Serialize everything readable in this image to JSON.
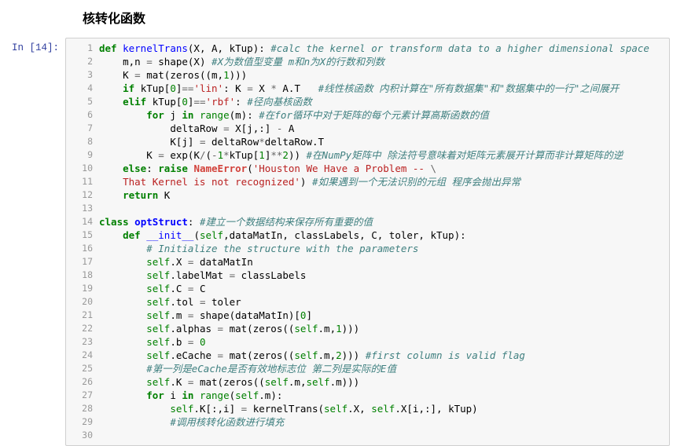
{
  "heading": "核转化函数",
  "prompt": "In [14]:",
  "lines": [
    {
      "n": "1",
      "html": "<span class='k'>def</span> <span class='nf'>kernelTrans</span><span class='n'>(X, A, kTup):</span> <span class='c'>#calc the kernel or transform data to a higher dimensional space</span>"
    },
    {
      "n": "2",
      "html": "    <span class='n'>m,n</span> <span class='o'>=</span> <span class='n'>shape(X)</span> <span class='c'>#X为数值型变量 m和n为X的行数和列数</span>"
    },
    {
      "n": "3",
      "html": "    <span class='n'>K</span> <span class='o'>=</span> <span class='n'>mat(zeros((m,</span><span class='m'>1</span><span class='n'>)))</span>"
    },
    {
      "n": "4",
      "html": "    <span class='k'>if</span> <span class='n'>kTup[</span><span class='m'>0</span><span class='n'>]</span><span class='o'>==</span><span class='s'>'lin'</span><span class='n'>: K</span> <span class='o'>=</span> <span class='n'>X</span> <span class='o'>*</span> <span class='n'>A.T</span>   <span class='c'>#线性核函数 内积计算在\"所有数据集\"和\"数据集中的一行\"之间展开</span>"
    },
    {
      "n": "5",
      "html": "    <span class='k'>elif</span> <span class='n'>kTup[</span><span class='m'>0</span><span class='n'>]</span><span class='o'>==</span><span class='s'>'rbf'</span><span class='n'>:</span> <span class='c'>#径向基核函数</span>"
    },
    {
      "n": "6",
      "html": "        <span class='k'>for</span> <span class='n'>j</span> <span class='k'>in</span> <span class='bi'>range</span><span class='n'>(m):</span> <span class='c'>#在for循环中对于矩阵的每个元素计算高斯函数的值</span>"
    },
    {
      "n": "7",
      "html": "            <span class='n'>deltaRow</span> <span class='o'>=</span> <span class='n'>X[j,:]</span> <span class='o'>-</span> <span class='n'>A</span>"
    },
    {
      "n": "8",
      "html": "            <span class='n'>K[j]</span> <span class='o'>=</span> <span class='n'>deltaRow</span><span class='o'>*</span><span class='n'>deltaRow.T</span>"
    },
    {
      "n": "9",
      "html": "        <span class='n'>K</span> <span class='o'>=</span> <span class='n'>exp(K</span><span class='o'>/</span><span class='n'>(</span><span class='o'>-</span><span class='m'>1</span><span class='o'>*</span><span class='n'>kTup[</span><span class='m'>1</span><span class='n'>]</span><span class='o'>**</span><span class='m'>2</span><span class='n'>))</span> <span class='c'>#在NumPy矩阵中 除法符号意味着对矩阵元素展开计算而非计算矩阵的逆</span>"
    },
    {
      "n": "10",
      "html": "    <span class='k'>else</span><span class='n'>:</span> <span class='k'>raise</span> <span class='ne'>NameError</span><span class='n'>(</span><span class='s'>'Houston We Have a Problem -- </span><span class='o'>\\</span>"
    },
    {
      "n": "11",
      "html": "<span class='s'>    That Kernel is not recognized'</span><span class='n'>)</span> <span class='c'>#如果遇到一个无法识别的元组 程序会抛出异常</span>"
    },
    {
      "n": "12",
      "html": "    <span class='k'>return</span> <span class='n'>K</span>"
    },
    {
      "n": "13",
      "html": ""
    },
    {
      "n": "14",
      "html": "<span class='k'>class</span> <span class='nc'>optStruct</span><span class='n'>:</span> <span class='c'>#建立一个数据结构来保存所有重要的值</span>"
    },
    {
      "n": "15",
      "html": "    <span class='k'>def</span> <span class='nf'>__init__</span><span class='n'>(</span><span class='bi'>self</span><span class='n'>,dataMatIn, classLabels, C, toler, kTup):</span>"
    },
    {
      "n": "16",
      "html": "        <span class='c'># Initialize the structure with the parameters</span>"
    },
    {
      "n": "17",
      "html": "        <span class='bi'>self</span><span class='n'>.X</span> <span class='o'>=</span> <span class='n'>dataMatIn</span>"
    },
    {
      "n": "18",
      "html": "        <span class='bi'>self</span><span class='n'>.labelMat</span> <span class='o'>=</span> <span class='n'>classLabels</span>"
    },
    {
      "n": "19",
      "html": "        <span class='bi'>self</span><span class='n'>.C</span> <span class='o'>=</span> <span class='n'>C</span>"
    },
    {
      "n": "20",
      "html": "        <span class='bi'>self</span><span class='n'>.tol</span> <span class='o'>=</span> <span class='n'>toler</span>"
    },
    {
      "n": "21",
      "html": "        <span class='bi'>self</span><span class='n'>.m</span> <span class='o'>=</span> <span class='n'>shape(dataMatIn)[</span><span class='m'>0</span><span class='n'>]</span>"
    },
    {
      "n": "22",
      "html": "        <span class='bi'>self</span><span class='n'>.alphas</span> <span class='o'>=</span> <span class='n'>mat(zeros((</span><span class='bi'>self</span><span class='n'>.m,</span><span class='m'>1</span><span class='n'>)))</span>"
    },
    {
      "n": "23",
      "html": "        <span class='bi'>self</span><span class='n'>.b</span> <span class='o'>=</span> <span class='m'>0</span>"
    },
    {
      "n": "24",
      "html": "        <span class='bi'>self</span><span class='n'>.eCache</span> <span class='o'>=</span> <span class='n'>mat(zeros((</span><span class='bi'>self</span><span class='n'>.m,</span><span class='m'>2</span><span class='n'>)))</span> <span class='c'>#first column is valid flag</span>"
    },
    {
      "n": "25",
      "html": "        <span class='c'>#第一列是eCache是否有效地标志位 第二列是实际的E值</span>"
    },
    {
      "n": "26",
      "html": "        <span class='bi'>self</span><span class='n'>.K</span> <span class='o'>=</span> <span class='n'>mat(zeros((</span><span class='bi'>self</span><span class='n'>.m,</span><span class='bi'>self</span><span class='n'>.m)))</span>"
    },
    {
      "n": "27",
      "html": "        <span class='k'>for</span> <span class='n'>i</span> <span class='k'>in</span> <span class='bi'>range</span><span class='n'>(</span><span class='bi'>self</span><span class='n'>.m):</span>"
    },
    {
      "n": "28",
      "html": "            <span class='bi'>self</span><span class='n'>.K[:,i]</span> <span class='o'>=</span> <span class='n'>kernelTrans(</span><span class='bi'>self</span><span class='n'>.X,</span> <span class='bi'>self</span><span class='n'>.X[i,:], kTup)</span>"
    },
    {
      "n": "29",
      "html": "            <span class='c'>#调用核转化函数进行填充</span>"
    },
    {
      "n": "30",
      "html": ""
    }
  ]
}
